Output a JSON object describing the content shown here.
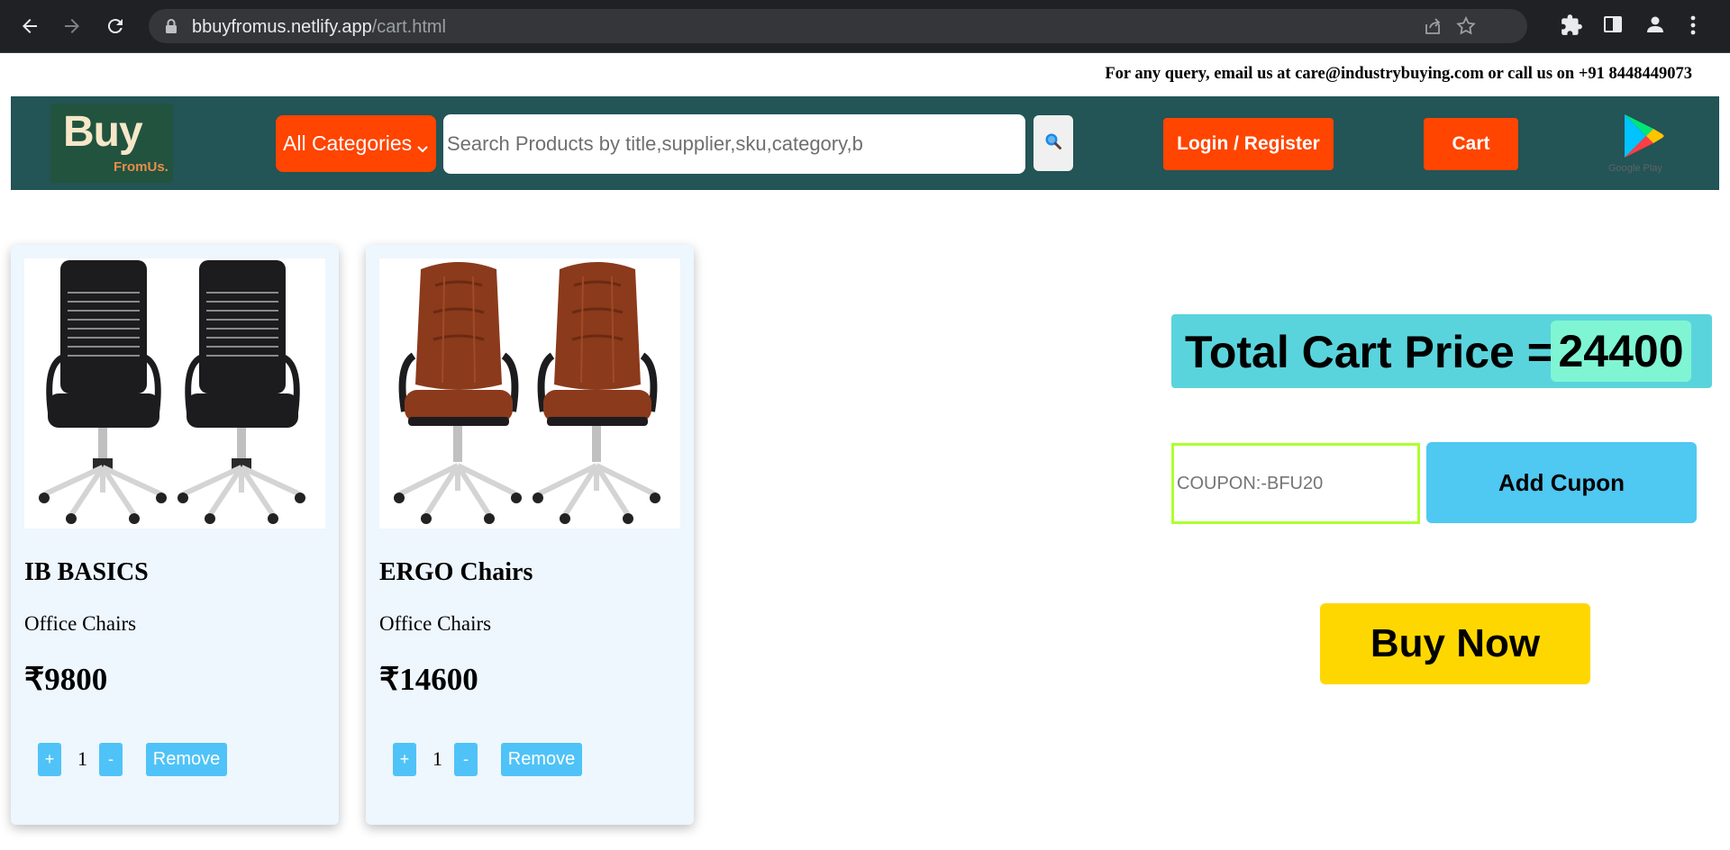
{
  "browser": {
    "url_host": "bbuyfromus.netlify.app",
    "url_path": "/cart.html"
  },
  "topbar": {
    "query_text": "For any query, email us at care@industrybuying.com or call us on +91 8448449073"
  },
  "header": {
    "logo_main": "Buy",
    "logo_sub": "FromUs.",
    "categories_label": "All Categories",
    "search_placeholder": "Search Products by title,supplier,sku,category,b",
    "login_label": "Login / Register",
    "cart_label": "Cart",
    "google_play_label": "Google Play"
  },
  "cart_items": [
    {
      "name": "IB BASICS",
      "category": "Office Chairs",
      "price": "₹9800",
      "quantity": "1",
      "plus_label": "+",
      "minus_label": "-",
      "remove_label": "Remove",
      "chair_color": "#1c1c1e"
    },
    {
      "name": "ERGO Chairs",
      "category": "Office Chairs",
      "price": "₹14600",
      "quantity": "1",
      "plus_label": "+",
      "minus_label": "-",
      "remove_label": "Remove",
      "chair_color": "#8b3a1c"
    }
  ],
  "summary": {
    "total_label": "Total Cart Price =",
    "total_value": "24400",
    "coupon_placeholder": "COUPON:-BFU20",
    "add_coupon_label": "Add Cupon",
    "buy_now_label": "Buy Now"
  },
  "colors": {
    "header_bg": "#235456",
    "accent_orange": "#ff4500",
    "button_blue": "#4fc3f7",
    "buy_now_yellow": "#ffd700"
  }
}
